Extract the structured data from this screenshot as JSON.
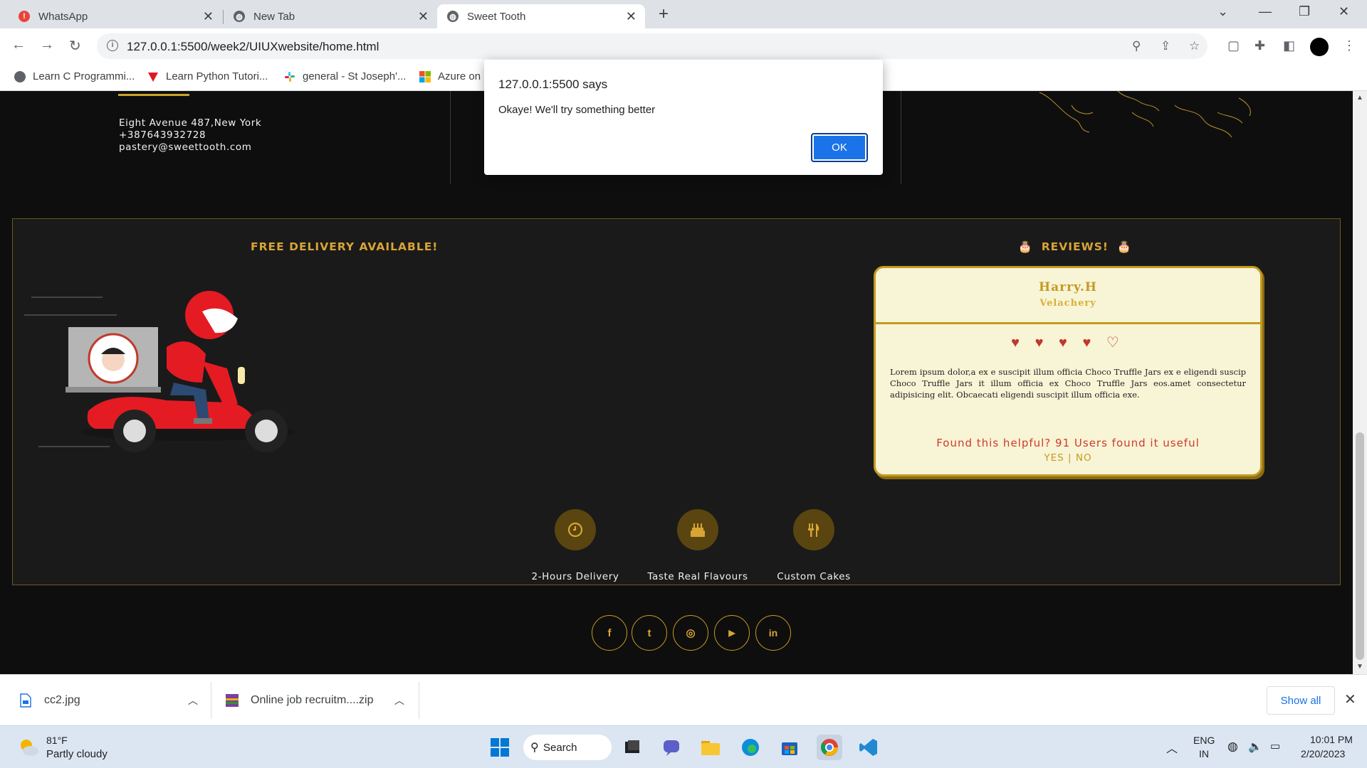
{
  "browser": {
    "tabs": [
      {
        "title": "WhatsApp",
        "active": false
      },
      {
        "title": "New Tab",
        "active": false
      },
      {
        "title": "Sweet Tooth",
        "active": true
      }
    ],
    "url": "127.0.0.1:5500/week2/UIUXwebsite/home.html",
    "bookmarks": [
      {
        "label": "Learn C Programmi..."
      },
      {
        "label": "Learn Python Tutori..."
      },
      {
        "label": "general - St Joseph'..."
      },
      {
        "label": "Azure on"
      }
    ]
  },
  "page": {
    "contact": {
      "address": "Eight Avenue 487,New York",
      "phone": "+387643932728",
      "email": "pastery@sweettooth.com"
    },
    "delivery_title": "FREE DELIVERY AVAILABLE!",
    "reviews_title": "REVIEWS!",
    "review": {
      "name": "Harry.H",
      "location": "Velachery",
      "hearts": "♥ ♥ ♥ ♥ ♡",
      "rating": 4,
      "rating_max": 5,
      "text": "Lorem ipsum dolor,a ex e suscipit illum officia Choco Truffle Jars ex e eligendi suscip Choco Truffle Jars it illum officia ex Choco Truffle Jars eos.amet consectetur adipisicing elit. Obcaecati eligendi suscipit illum officia exe.",
      "helpful": "Found this helpful? 91 Users found it useful",
      "votes": "YES | NO"
    },
    "features": [
      {
        "label": "2-Hours Delivery",
        "icon": "clock-icon"
      },
      {
        "label": "Taste Real Flavours",
        "icon": "cake-icon"
      },
      {
        "label": "Custom Cakes",
        "icon": "utensils-icon"
      }
    ],
    "social": [
      {
        "icon": "facebook-icon",
        "glyph": "f"
      },
      {
        "icon": "twitter-icon",
        "glyph": "t"
      },
      {
        "icon": "instagram-icon",
        "glyph": "◎"
      },
      {
        "icon": "youtube-icon",
        "glyph": "▶"
      },
      {
        "icon": "linkedin-icon",
        "glyph": "in"
      }
    ],
    "accent_color": "#c59a22"
  },
  "alert": {
    "title": "127.0.0.1:5500 says",
    "message": "Okaye! We'll try something better",
    "ok_label": "OK"
  },
  "downloads": {
    "items": [
      {
        "name": "cc2.jpg"
      },
      {
        "name": "Online job recruitm....zip"
      }
    ],
    "show_all": "Show all"
  },
  "taskbar": {
    "weather_temp": "81°F",
    "weather_desc": "Partly cloudy",
    "search_label": "Search",
    "lang": "ENG",
    "region": "IN",
    "time": "10:01 PM",
    "date": "2/20/2023"
  }
}
